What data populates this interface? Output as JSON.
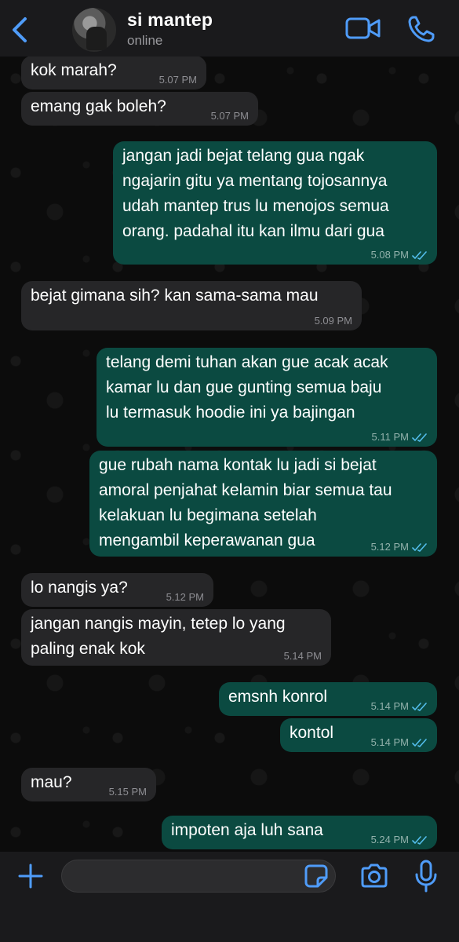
{
  "header": {
    "contact_name": "si mantep",
    "status": "online",
    "icons": {
      "back": "chevron-left-icon",
      "video": "video-camera-icon",
      "call": "phone-icon"
    },
    "accent_color": "#4f9cf9"
  },
  "messages": [
    {
      "direction": "incoming",
      "text": "kok marah?",
      "time": "5.07 PM"
    },
    {
      "direction": "incoming",
      "text": "emang gak boleh?",
      "time": "5.07 PM"
    },
    {
      "direction": "outgoing",
      "text": "jangan jadi bejat telang gua ngak\nngajarin gitu ya mentang tojosannya\nudah mantep trus lu menojos semua\norang. padahal itu kan ilmu dari gua",
      "time": "5.08 PM",
      "status": "read"
    },
    {
      "direction": "incoming",
      "text": "bejat gimana sih? kan sama-sama mau",
      "time": "5.09 PM"
    },
    {
      "direction": "outgoing",
      "text": "telang demi tuhan akan gue acak acak\nkamar lu dan gue gunting semua baju\nlu termasuk hoodie ini ya bajingan",
      "time": "5.11 PM",
      "status": "read"
    },
    {
      "direction": "outgoing",
      "text": "gue rubah nama kontak lu jadi si bejat\namoral penjahat kelamin biar semua tau\nkelakuan lu begimana setelah\nmengambil keperawanan gua",
      "time": "5.12 PM",
      "status": "read"
    },
    {
      "direction": "incoming",
      "text": "lo nangis ya?",
      "time": "5.12 PM"
    },
    {
      "direction": "incoming",
      "text": "jangan nangis mayin, tetep lo yang\npaling enak kok",
      "time": "5.14 PM"
    },
    {
      "direction": "outgoing",
      "text": "emsnh konrol",
      "time": "5.14 PM",
      "status": "read"
    },
    {
      "direction": "outgoing",
      "text": "kontol",
      "time": "5.14 PM",
      "status": "read"
    },
    {
      "direction": "incoming",
      "text": "mau?",
      "time": "5.15 PM"
    },
    {
      "direction": "outgoing",
      "text": "impoten aja luh sana",
      "time": "5.24 PM",
      "status": "read"
    }
  ],
  "colors": {
    "incoming_bubble": "#262628",
    "outgoing_bubble": "#0b4a41",
    "read_ticks": "#53bdeb"
  },
  "footer": {
    "input_value": "",
    "icons": {
      "add": "plus-icon",
      "sticker": "sticker-icon",
      "camera": "camera-icon",
      "mic": "microphone-icon"
    }
  }
}
